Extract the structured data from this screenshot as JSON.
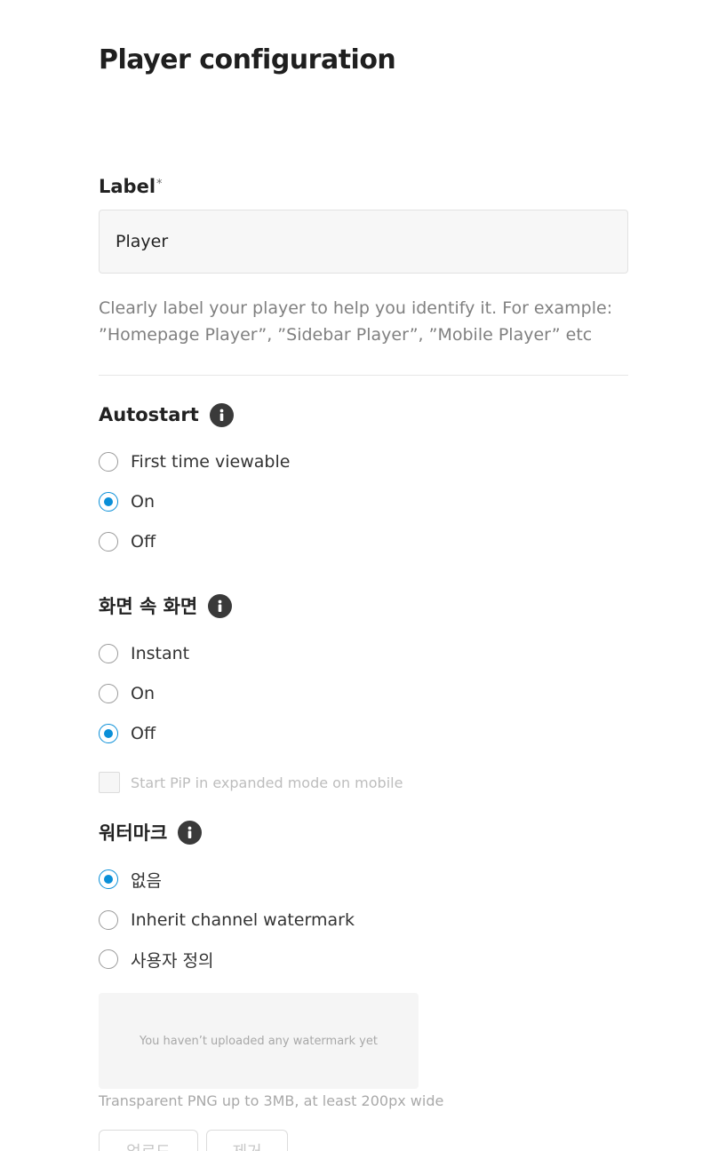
{
  "page": {
    "title": "Player configuration"
  },
  "label_field": {
    "label": "Label",
    "required_mark": "*",
    "value": "Player",
    "help_line1": "Clearly label your player to help you identify it. For example:",
    "help_line2": "”Homepage Player”, ”Sidebar Player”, ”Mobile Player” etc"
  },
  "autostart": {
    "title": "Autostart",
    "info_icon": "info-icon",
    "options": [
      {
        "label": "First time viewable",
        "checked": false
      },
      {
        "label": "On",
        "checked": true
      },
      {
        "label": "Off",
        "checked": false
      }
    ]
  },
  "pip": {
    "title": "화면 속 화면",
    "info_icon": "info-icon",
    "options": [
      {
        "label": "Instant",
        "checked": false
      },
      {
        "label": "On",
        "checked": false
      },
      {
        "label": "Off",
        "checked": true
      }
    ],
    "expanded_checkbox": {
      "label": "Start PiP in expanded mode on mobile",
      "checked": false,
      "disabled": true
    }
  },
  "watermark": {
    "title": "워터마크",
    "info_icon": "info-icon",
    "options": [
      {
        "label": "없음",
        "checked": true
      },
      {
        "label": "Inherit channel watermark",
        "checked": false
      },
      {
        "label": "사용자 정의",
        "checked": false
      }
    ],
    "empty_text": "You haven’t uploaded any watermark yet",
    "note": "Transparent PNG up to 3MB, at least 200px wide",
    "upload_label": "업로드",
    "remove_label": "제거"
  },
  "colors": {
    "accent": "#0a8fd8",
    "icon_bg": "#3a3a3a",
    "input_bg": "#f7f7f7",
    "help_text": "#808080"
  }
}
